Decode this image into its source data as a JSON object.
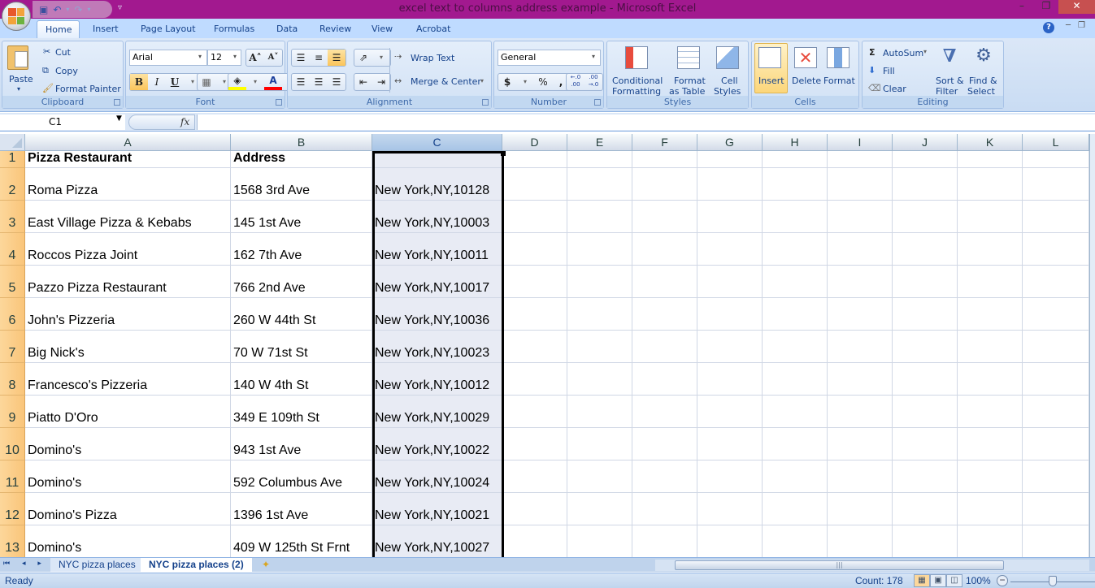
{
  "window": {
    "title": "excel text to columns address example - Microsoft Excel",
    "minimize": "–",
    "restore": "❐",
    "close": "✕"
  },
  "qat": {
    "save": "💾",
    "undo": "↶",
    "redo": "↷",
    "more": "▿"
  },
  "ribbon_tabs": [
    "Home",
    "Insert",
    "Page Layout",
    "Formulas",
    "Data",
    "Review",
    "View",
    "Acrobat"
  ],
  "active_tab": "Home",
  "help_icon": "?",
  "clipboard": {
    "label": "Clipboard",
    "paste": "Paste",
    "cut": "Cut",
    "copy": "Copy",
    "format_painter": "Format Painter"
  },
  "font": {
    "label": "Font",
    "name": "Arial",
    "size": "12",
    "grow": "A˄",
    "shrink": "A˅",
    "bold": "B",
    "italic": "I",
    "underline": "U",
    "fill_color": "#ffff00",
    "font_color": "#ff0000"
  },
  "alignment": {
    "label": "Alignment",
    "wrap_text": "Wrap Text",
    "merge_center": "Merge & Center"
  },
  "number": {
    "label": "Number",
    "format": "General",
    "currency": "$",
    "percent": "%",
    "comma": ",",
    "inc_decimal": "←.0 .00",
    "dec_decimal": ".00 →.0"
  },
  "styles": {
    "label": "Styles",
    "conditional_1": "Conditional",
    "conditional_2": "Formatting",
    "table_1": "Format",
    "table_2": "as Table",
    "cell_1": "Cell",
    "cell_2": "Styles"
  },
  "cells": {
    "label": "Cells",
    "insert": "Insert",
    "delete": "Delete",
    "format": "Format"
  },
  "editing": {
    "label": "Editing",
    "autosum": "AutoSum",
    "fill": "Fill",
    "clear": "Clear",
    "sort_1": "Sort &",
    "sort_2": "Filter",
    "find_1": "Find &",
    "find_2": "Select"
  },
  "formula_bar": {
    "name_box": "C1",
    "fx": "fx",
    "value": ""
  },
  "sheet": {
    "columns": [
      "A",
      "B",
      "C",
      "D",
      "E",
      "F",
      "G",
      "H",
      "I",
      "J",
      "K",
      "L"
    ],
    "selected_column": "C",
    "rows": [
      {
        "n": "1",
        "a": "Pizza Restaurant",
        "b": "Address",
        "c": ""
      },
      {
        "n": "2",
        "a": "Roma Pizza",
        "b": "1568 3rd Ave",
        "c": "New York,NY,10128"
      },
      {
        "n": "3",
        "a": "East Village Pizza & Kebabs",
        "b": "145 1st Ave",
        "c": "New York,NY,10003"
      },
      {
        "n": "4",
        "a": "Roccos Pizza Joint",
        "b": "162 7th Ave",
        "c": "New York,NY,10011"
      },
      {
        "n": "5",
        "a": "Pazzo Pizza Restaurant",
        "b": "766 2nd Ave",
        "c": "New York,NY,10017"
      },
      {
        "n": "6",
        "a": "John's Pizzeria",
        "b": "260 W 44th St",
        "c": "New York,NY,10036"
      },
      {
        "n": "7",
        "a": "Big Nick's",
        "b": "70 W 71st St",
        "c": "New York,NY,10023"
      },
      {
        "n": "8",
        "a": "Francesco's Pizzeria",
        "b": "140 W 4th St",
        "c": "New York,NY,10012"
      },
      {
        "n": "9",
        "a": "Piatto D'Oro",
        "b": "349 E 109th St",
        "c": "New York,NY,10029"
      },
      {
        "n": "10",
        "a": "Domino's",
        "b": "943 1st Ave",
        "c": "New York,NY,10022"
      },
      {
        "n": "11",
        "a": "Domino's",
        "b": "592 Columbus Ave",
        "c": "New York,NY,10024"
      },
      {
        "n": "12",
        "a": "Domino's Pizza",
        "b": "1396 1st Ave",
        "c": "New York,NY,10021"
      },
      {
        "n": "13",
        "a": "Domino's",
        "b": "409 W 125th St Frnt",
        "c": "New York,NY,10027"
      }
    ]
  },
  "sheet_tabs": {
    "nav": "⏮ ◂ ▸ ⏭",
    "tabs": [
      "NYC pizza places",
      "NYC pizza places (2)"
    ],
    "active": "NYC pizza places (2)",
    "insert_icon": "✦"
  },
  "status": {
    "ready": "Ready",
    "count": "Count: 178",
    "zoom": "100%",
    "zoom_level_percent": 100
  },
  "colors": {
    "title_bar": "#a2198f",
    "ribbon_tab_bg": "#bfdbff",
    "selected_col_bg": "#e8ebf4",
    "row_header": "#fac57a"
  }
}
